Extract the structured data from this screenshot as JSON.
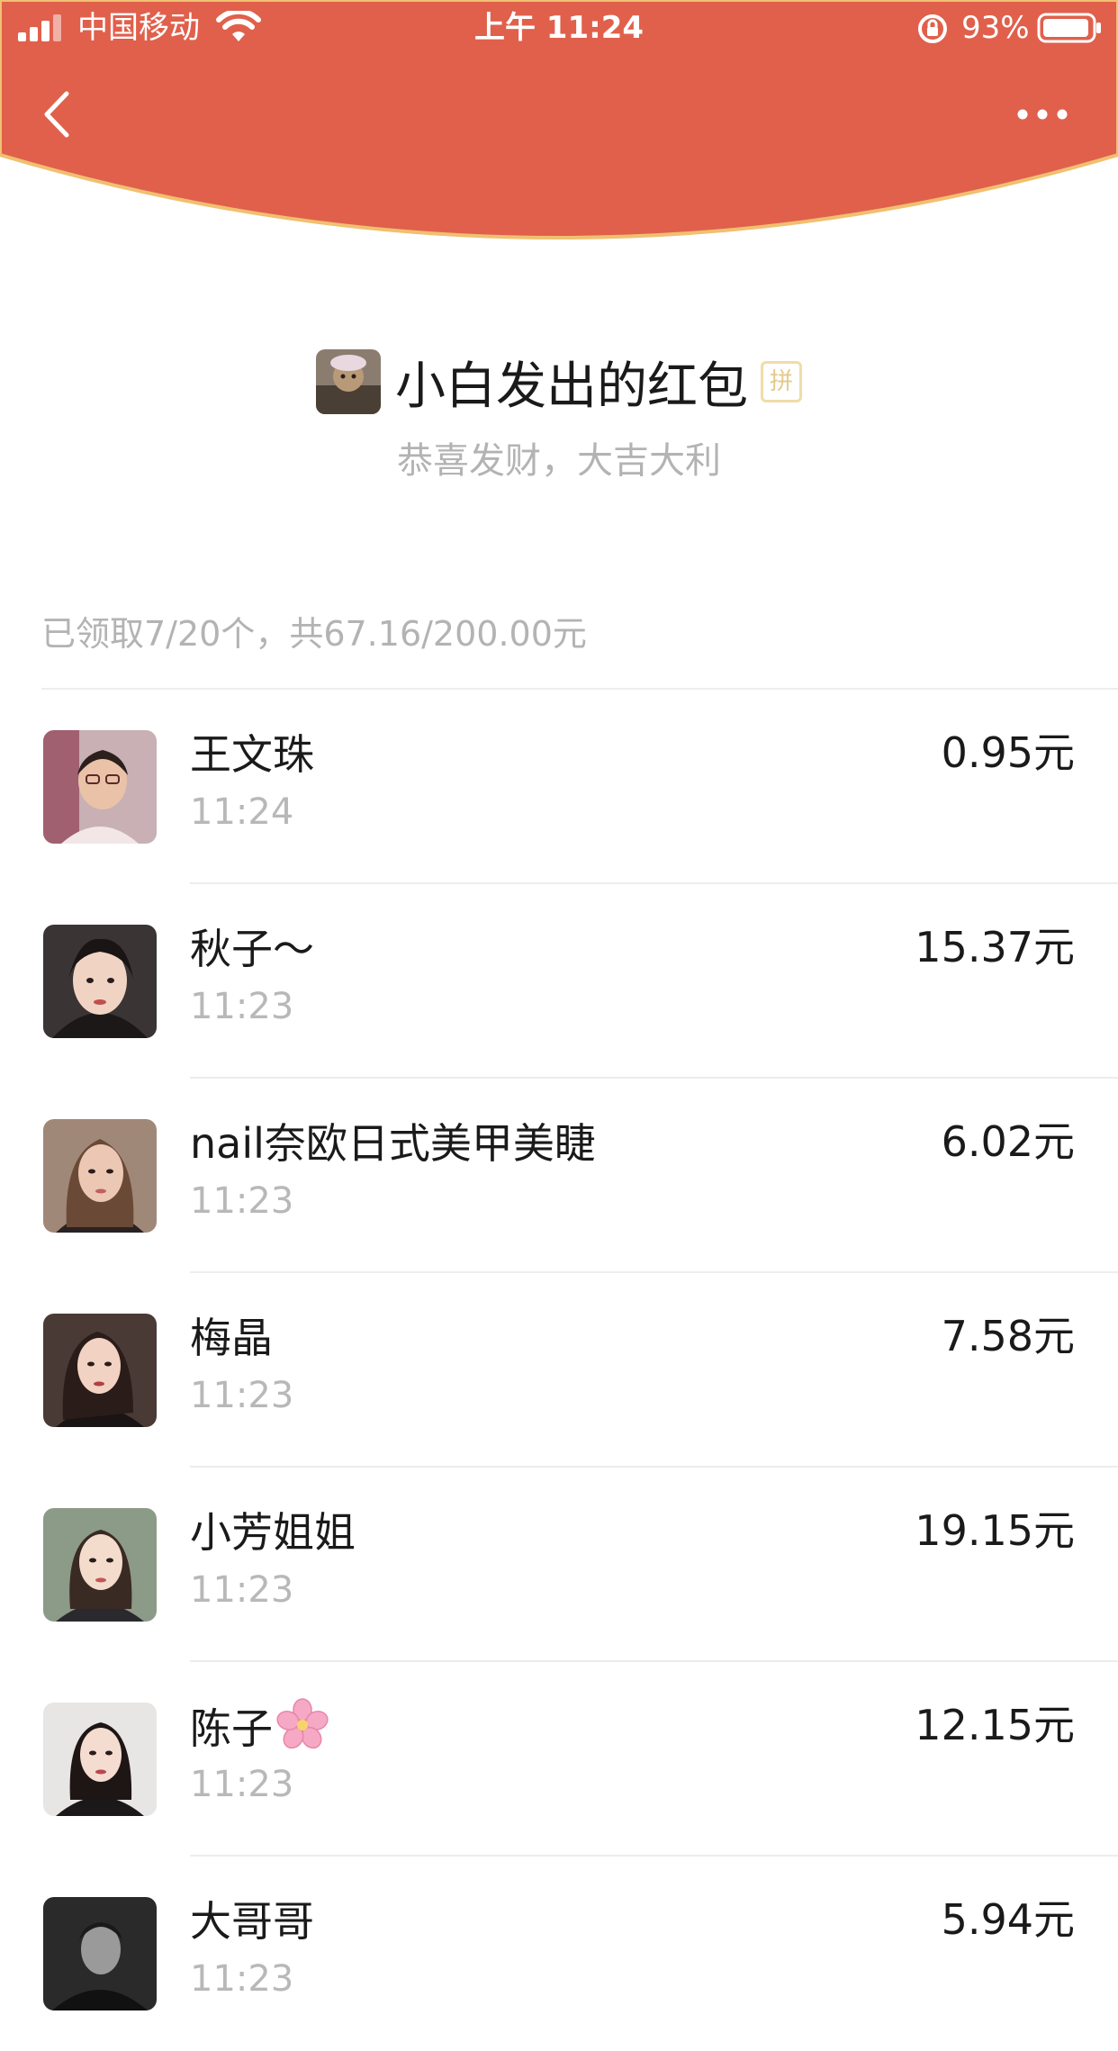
{
  "status_bar": {
    "carrier": "中国移动",
    "time": "上午 11:24",
    "battery": "93%"
  },
  "colors": {
    "header_red": "#e0604c",
    "header_border": "#f0c070"
  },
  "header": {
    "title": "小白发出的红包",
    "badge": "拼",
    "greeting": "恭喜发财，大吉大利"
  },
  "summary": "已领取7/20个，共67.16/200.00元",
  "recipients": [
    {
      "name": "王文珠",
      "time": "11:24",
      "amount": "0.95元"
    },
    {
      "name": "秋子～",
      "time": "11:23",
      "amount": "15.37元"
    },
    {
      "name": "nail奈欧日式美甲美睫",
      "time": "11:23",
      "amount": "6.02元"
    },
    {
      "name": "梅晶",
      "time": "11:23",
      "amount": "7.58元"
    },
    {
      "name": "小芳姐姐",
      "time": "11:23",
      "amount": "19.15元"
    },
    {
      "name": "陈子",
      "time": "11:23",
      "amount": "12.15元"
    },
    {
      "name": "大哥哥",
      "time": "11:23",
      "amount": "5.94元"
    }
  ]
}
